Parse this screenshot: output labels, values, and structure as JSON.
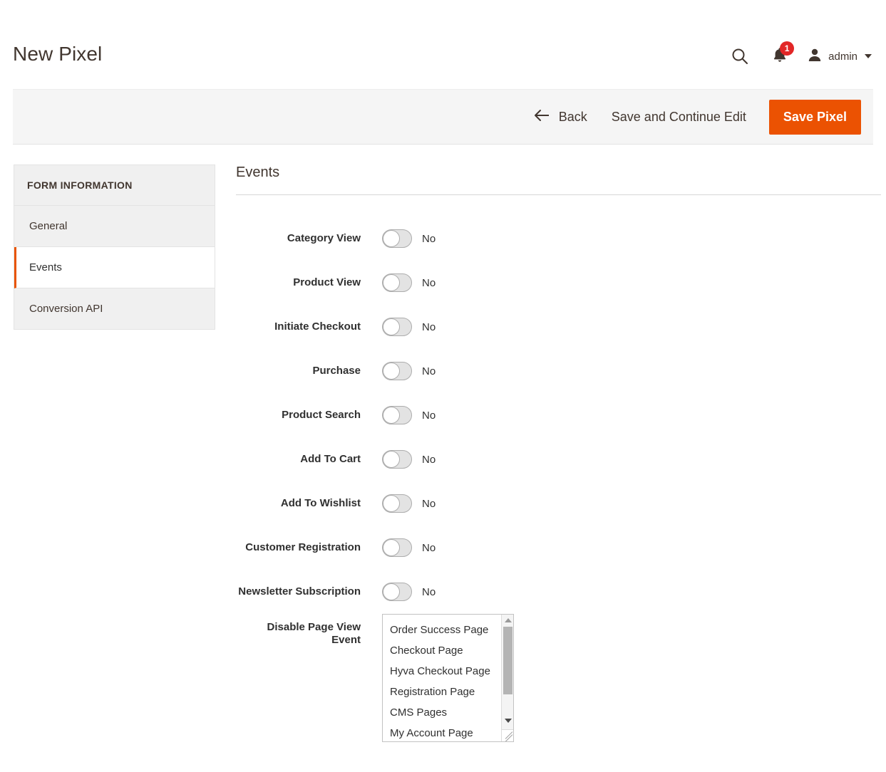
{
  "header": {
    "title": "New Pixel",
    "search_icon": "search-icon",
    "notifications": {
      "icon": "bell-icon",
      "count": "1"
    },
    "user": {
      "icon": "user-avatar-icon",
      "name": "admin",
      "caret": "chevron-down-icon"
    }
  },
  "action_bar": {
    "back_label": "Back",
    "back_icon": "arrow-left-icon",
    "save_continue_label": "Save and Continue Edit",
    "save_label": "Save Pixel",
    "primary_color": "#eb5202"
  },
  "sidebar": {
    "title": "FORM INFORMATION",
    "active_accent_color": "#e85400",
    "items": [
      {
        "label": "General",
        "active": false
      },
      {
        "label": "Events",
        "active": true
      },
      {
        "label": "Conversion API",
        "active": false
      }
    ]
  },
  "main": {
    "section_title": "Events",
    "toggle_fields": [
      {
        "label": "Category View",
        "value": "No"
      },
      {
        "label": "Product View",
        "value": "No"
      },
      {
        "label": "Initiate Checkout",
        "value": "No"
      },
      {
        "label": "Purchase",
        "value": "No"
      },
      {
        "label": "Product Search",
        "value": "No"
      },
      {
        "label": "Add To Cart",
        "value": "No"
      },
      {
        "label": "Add To Wishlist",
        "value": "No"
      },
      {
        "label": "Customer Registration",
        "value": "No"
      },
      {
        "label": "Newsletter Subscription",
        "value": "No"
      }
    ],
    "multiselect_field": {
      "label": "Disable Page View Event",
      "options": [
        "Order Success Page",
        "Checkout Page",
        "Hyva Checkout Page",
        "Registration Page",
        "CMS Pages",
        "My Account Page"
      ]
    }
  }
}
